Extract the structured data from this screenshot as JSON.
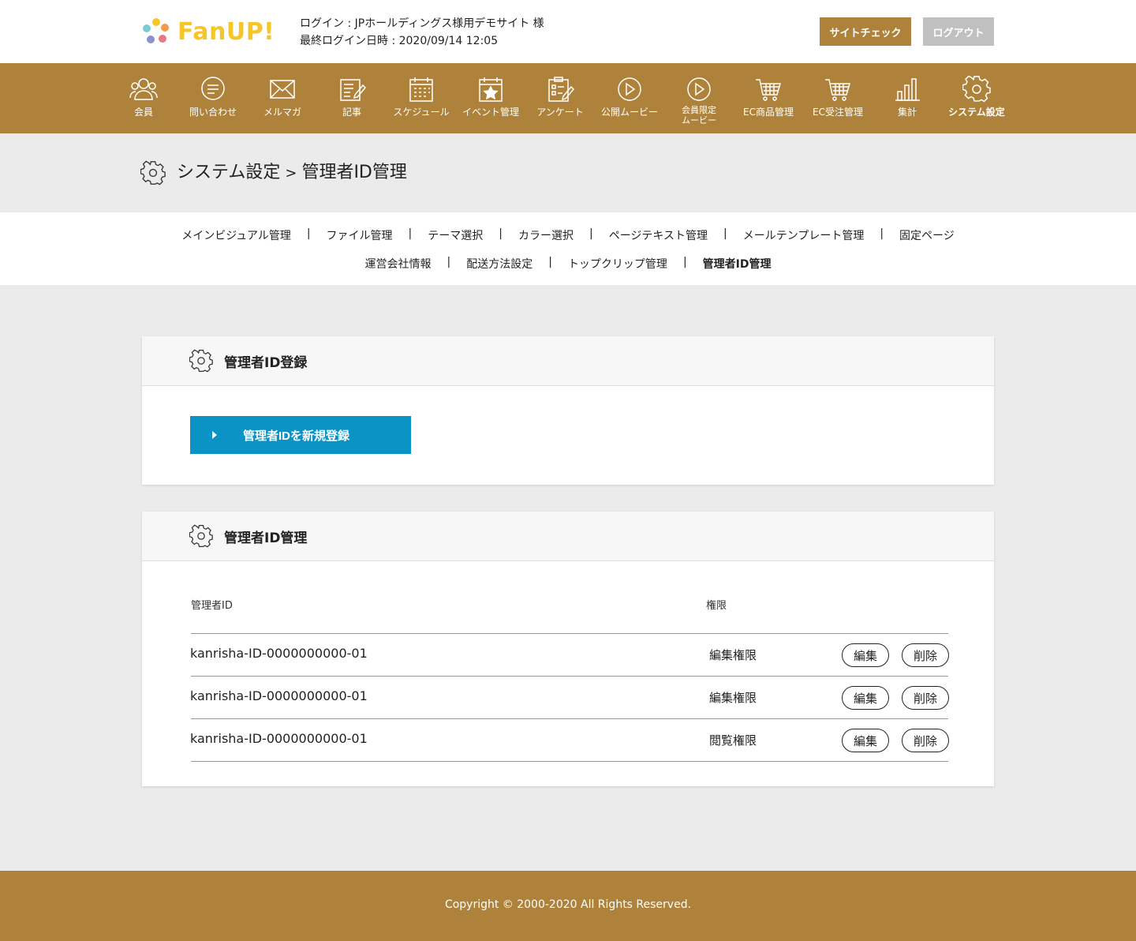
{
  "header": {
    "logo_text": "FanUP!",
    "login_line1": "ログイン : JPホールディングス様用デモサイト 様",
    "login_line2": "最終ログイン日時 : 2020/09/14 12:05",
    "site_check_label": "サイトチェック",
    "logout_label": "ログアウト"
  },
  "nav": {
    "items": [
      {
        "label": "会員",
        "icon": "members-icon"
      },
      {
        "label": "問い合わせ",
        "icon": "inquiry-icon"
      },
      {
        "label": "メルマガ",
        "icon": "mail-icon"
      },
      {
        "label": "記事",
        "icon": "article-icon"
      },
      {
        "label": "スケジュール",
        "icon": "calendar-icon"
      },
      {
        "label": "イベント管理",
        "icon": "event-icon"
      },
      {
        "label": "アンケート",
        "icon": "survey-icon"
      },
      {
        "label": "公開ムービー",
        "icon": "play-icon"
      },
      {
        "label": "会員限定ムービー",
        "icon": "play-icon"
      },
      {
        "label": "EC商品管理",
        "icon": "cart-icon"
      },
      {
        "label": "EC受注管理",
        "icon": "cart-icon"
      },
      {
        "label": "集計",
        "icon": "chart-icon"
      },
      {
        "label": "システム設定",
        "icon": "gear-icon",
        "active": true
      }
    ]
  },
  "breadcrumb": {
    "parent": "システム設定",
    "separator": ">",
    "current": "管理者ID管理"
  },
  "subnav": {
    "row1": [
      "メインビジュアル管理",
      "ファイル管理",
      "テーマ選択",
      "カラー選択",
      "ページテキスト管理",
      "メールテンプレート管理",
      "固定ページ"
    ],
    "row2": [
      "運営会社情報",
      "配送方法設定",
      "トップクリップ管理",
      "管理者ID管理"
    ],
    "separator": "|",
    "current": "管理者ID管理"
  },
  "register_card": {
    "title": "管理者ID登録",
    "button_label": "管理者IDを新規登録"
  },
  "manage_card": {
    "title": "管理者ID管理",
    "columns": {
      "id": "管理者ID",
      "permission": "権限"
    },
    "rows": [
      {
        "id": "kanrisha-ID-0000000000-01",
        "permission": "編集権限",
        "edit": "編集",
        "delete": "削除"
      },
      {
        "id": "kanrisha-ID-0000000000-01",
        "permission": "編集権限",
        "edit": "編集",
        "delete": "削除"
      },
      {
        "id": "kanrisha-ID-0000000000-01",
        "permission": "閲覧権限",
        "edit": "編集",
        "delete": "削除"
      }
    ]
  },
  "footer": {
    "copyright": "Copyright © 2000-2020 All Rights Reserved."
  },
  "colors": {
    "brand": "#ae823a",
    "primary_button": "#0b93c6",
    "logout_button": "#c0c0c0",
    "logo_yellow": "#f6c629"
  }
}
